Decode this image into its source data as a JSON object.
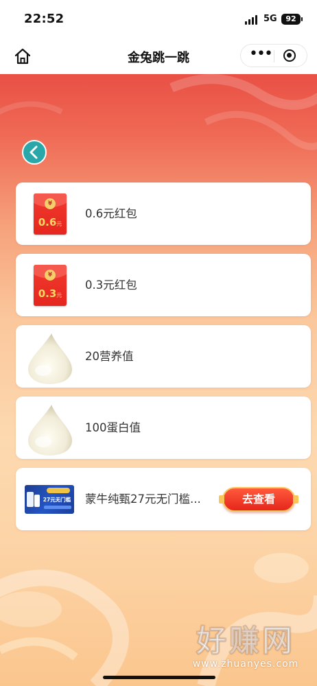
{
  "status_bar": {
    "time": "22:52",
    "network": "5G",
    "battery": "92"
  },
  "nav": {
    "title": "金兔跳一跳",
    "more_icon": "•••"
  },
  "rewards": [
    {
      "icon": "red-packet-icon",
      "amount": "0.6",
      "unit": "元",
      "label": "0.6元红包"
    },
    {
      "icon": "red-packet-icon",
      "amount": "0.3",
      "unit": "元",
      "label": "0.3元红包"
    },
    {
      "icon": "milk-drop-icon",
      "label": "20营养值"
    },
    {
      "icon": "milk-drop-icon",
      "label": "100蛋白值"
    }
  ],
  "ad": {
    "thumbnail_text": "27元无门槛",
    "label": "蒙牛纯甄27元无门槛...",
    "button": "去查看"
  },
  "watermark": {
    "text": "好赚网",
    "url": "www.zhuanyes.com"
  },
  "colors": {
    "accent_red": "#e5261c",
    "back_button": "#2aa7a8"
  }
}
